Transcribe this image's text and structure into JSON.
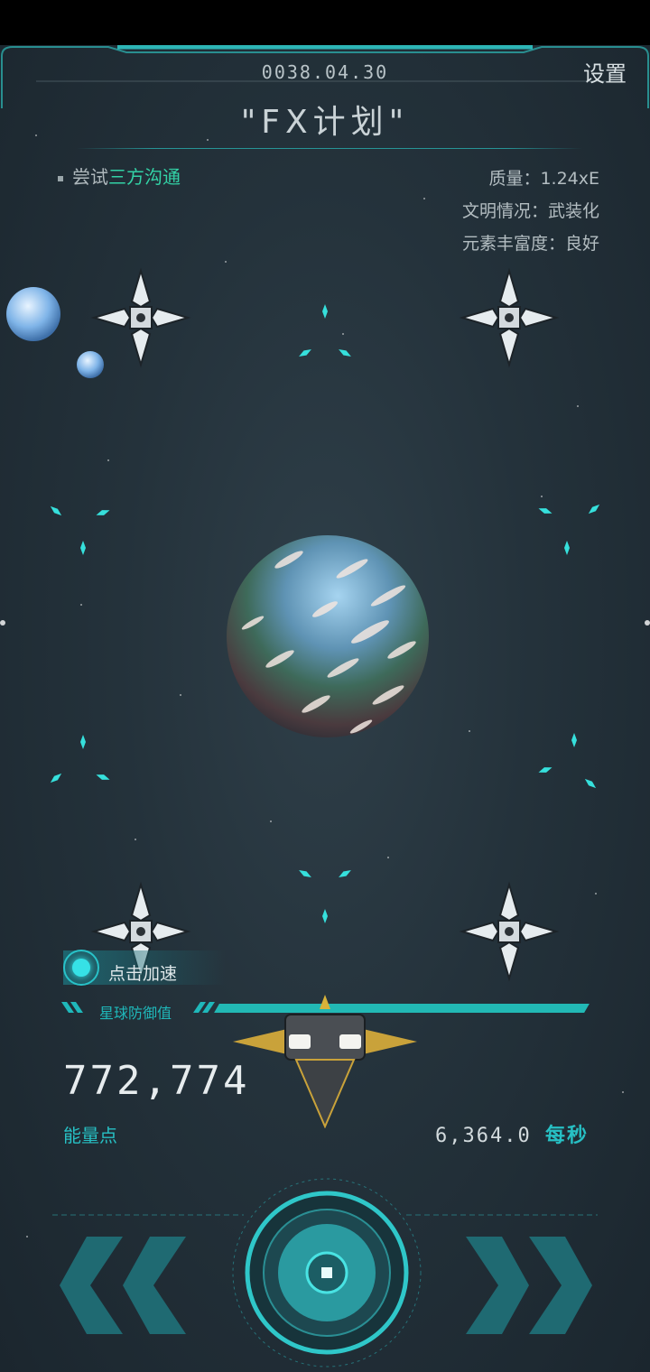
{
  "header": {
    "date": "0038.04.30",
    "settings_label": "设置",
    "title": "\"FX计划\""
  },
  "task": {
    "prefix": "尝试",
    "highlight": "三方沟通"
  },
  "planet_stats": {
    "mass": "质量：1.24xE",
    "civilization": "文明情况：武装化",
    "elements": "元素丰富度：良好"
  },
  "accelerate_label": "点击加速",
  "defense_label": "星球防御值",
  "energy_value": "772,774",
  "energy_label": "能量点",
  "rate_value": "6,364.0",
  "rate_unit": "每秒",
  "colors": {
    "accent": "#27c0c4",
    "highlight": "#33d2a6",
    "background": "#24323b"
  }
}
